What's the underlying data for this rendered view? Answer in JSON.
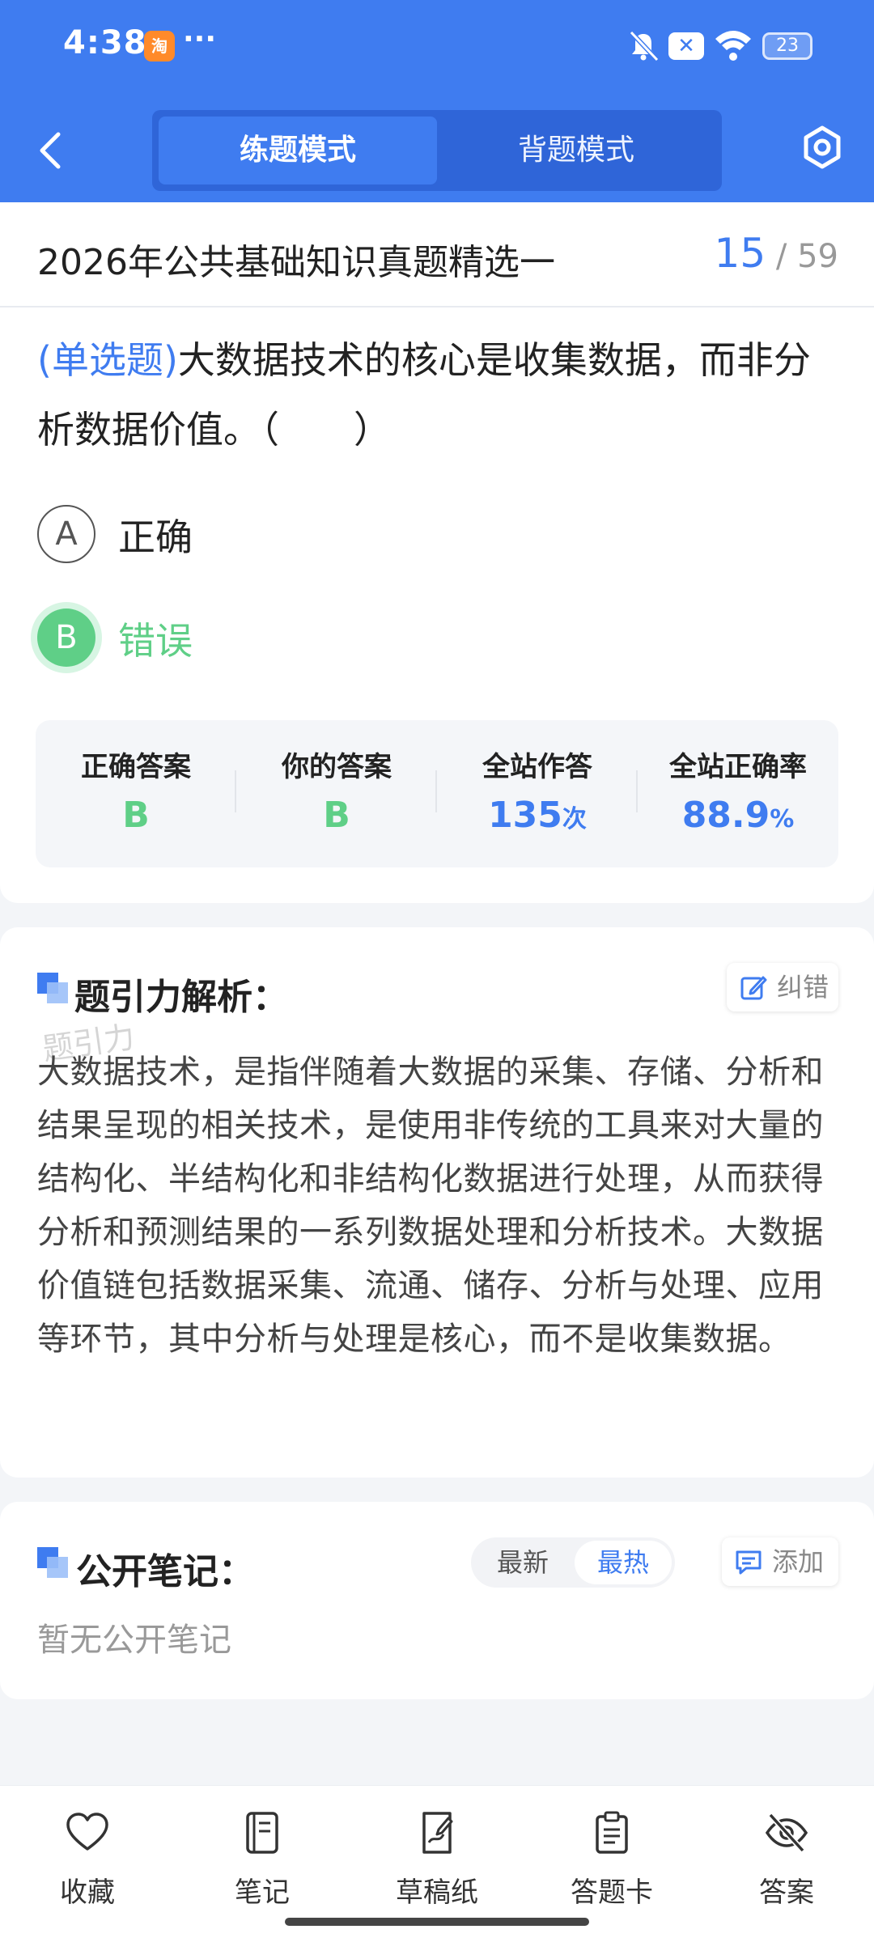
{
  "status_bar": {
    "time": "4:38",
    "app_badge": "淘",
    "more": "···",
    "battery": "23"
  },
  "nav": {
    "modes": [
      "练题模式",
      "背题模式"
    ],
    "active_mode": "练题模式"
  },
  "quiz": {
    "title": "2026年公共基础知识真题精选一",
    "current": "15",
    "separator": "/",
    "total": "59"
  },
  "question": {
    "type": "(单选题)",
    "text": "大数据技术的核心是收集数据，而非分析数据价值。（　　）",
    "options": [
      {
        "letter": "A",
        "text": "正确"
      },
      {
        "letter": "B",
        "text": "错误"
      }
    ],
    "selected": "B"
  },
  "stats": [
    {
      "label": "正确答案",
      "value": "B",
      "unit": ""
    },
    {
      "label": "你的答案",
      "value": "B",
      "unit": ""
    },
    {
      "label": "全站作答",
      "value": "135",
      "unit": "次"
    },
    {
      "label": "全站正确率",
      "value": "88.9",
      "unit": "%"
    }
  ],
  "analysis": {
    "title": "题引力解析：",
    "correct_button": "纠错",
    "watermark": "题引力",
    "text": "大数据技术，是指伴随着大数据的采集、存储、分析和结果呈现的相关技术，是使用非传统的工具来对大量的结构化、半结构化和非结构化数据进行处理，从而获得分析和预测结果的一系列数据处理和分析技术。大数据价值链包括数据采集、流通、储存、分析与处理、应用等环节，其中分析与处理是核心，而不是收集数据。"
  },
  "notes": {
    "title": "公开笔记：",
    "sort_options": [
      "最新",
      "最热"
    ],
    "active_sort": "最热",
    "add_button": "添加",
    "empty_text": "暂无公开笔记"
  },
  "bottom_bar": {
    "items": [
      {
        "label": "收藏",
        "icon": "heart-icon"
      },
      {
        "label": "笔记",
        "icon": "notebook-icon"
      },
      {
        "label": "草稿纸",
        "icon": "draft-paper-icon"
      },
      {
        "label": "答题卡",
        "icon": "answer-sheet-icon"
      },
      {
        "label": "答案",
        "icon": "eye-off-icon"
      }
    ]
  },
  "colors": {
    "primary": "#3f7cf0",
    "correct": "#5fcf87"
  }
}
